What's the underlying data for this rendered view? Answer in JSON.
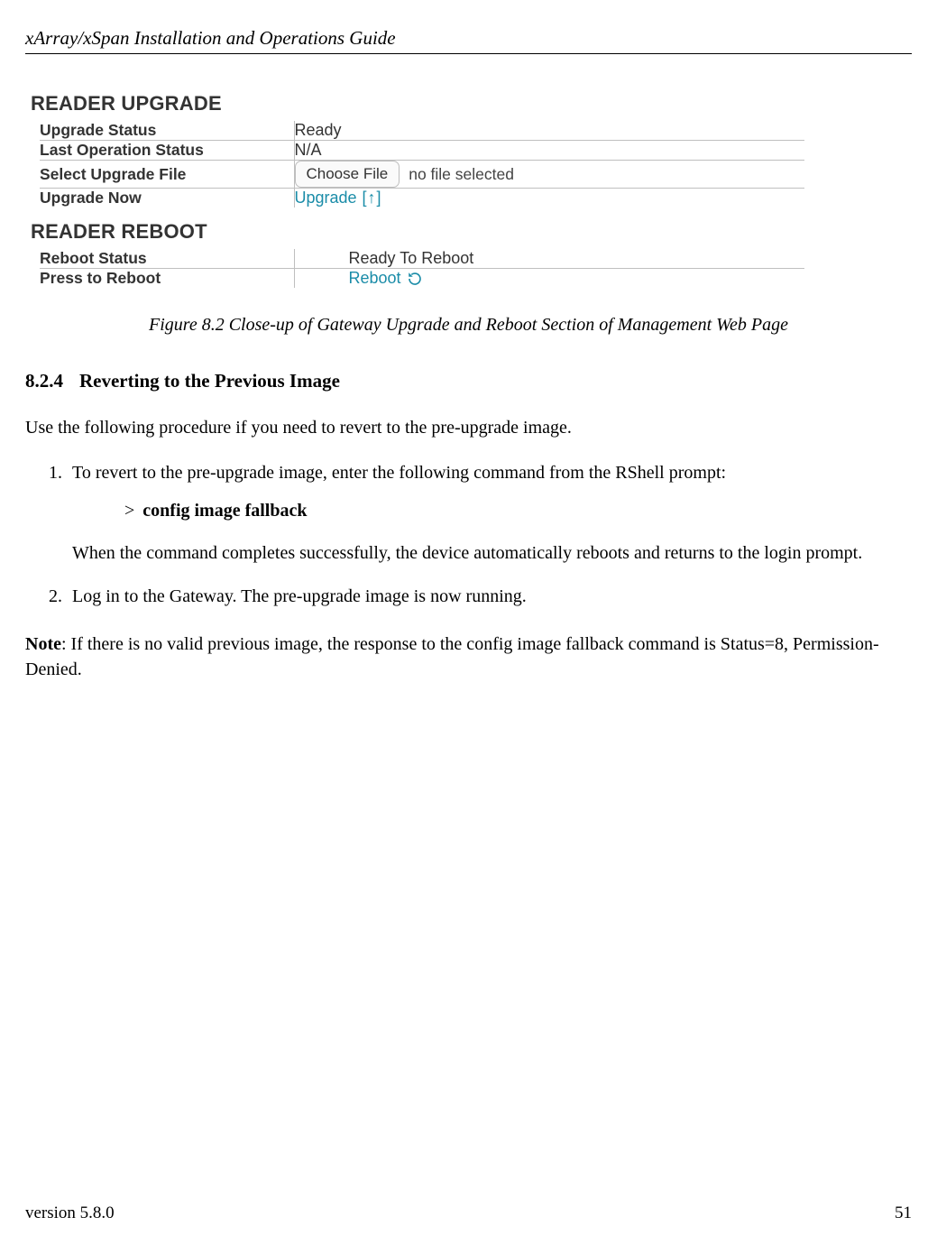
{
  "header": {
    "title": "xArray/xSpan Installation and Operations Guide"
  },
  "ui": {
    "upgrade": {
      "heading": "READER UPGRADE",
      "rows": {
        "status_label": "Upgrade Status",
        "status_value": "Ready",
        "lastop_label": "Last Operation Status",
        "lastop_value": "N/A",
        "selectfile_label": "Select Upgrade File",
        "choose_btn": "Choose File",
        "nofile_text": "no file selected",
        "upgradenow_label": "Upgrade Now",
        "upgrade_link": "Upgrade"
      }
    },
    "reboot": {
      "heading": "READER REBOOT",
      "rows": {
        "status_label": "Reboot Status",
        "status_value": "Ready To Reboot",
        "press_label": "Press to Reboot",
        "reboot_link": "Reboot"
      }
    }
  },
  "figure": {
    "caption": "Figure 8.2 Close-up of Gateway Upgrade and Reboot Section of Management Web Page"
  },
  "subsection": {
    "number": "8.2.4",
    "title": "Reverting to the Previous Image"
  },
  "body": {
    "intro": "Use the following procedure if you need to revert to the pre-upgrade image.",
    "step1_lead": "To revert to the pre-upgrade image, enter the following command from the RShell prompt:",
    "cmd_prompt": ">",
    "cmd_text": "config image fallback",
    "step1_tail": "When the command completes successfully, the device automatically reboots and returns to the login prompt.",
    "step2": "Log in to the Gateway. The pre-upgrade image is now running.",
    "note_label": "Note",
    "note_text": ": If there is no valid previous image, the response to the config image fallback command is Status=8, Permission-Denied."
  },
  "footer": {
    "version": "version 5.8.0",
    "page": "51"
  }
}
